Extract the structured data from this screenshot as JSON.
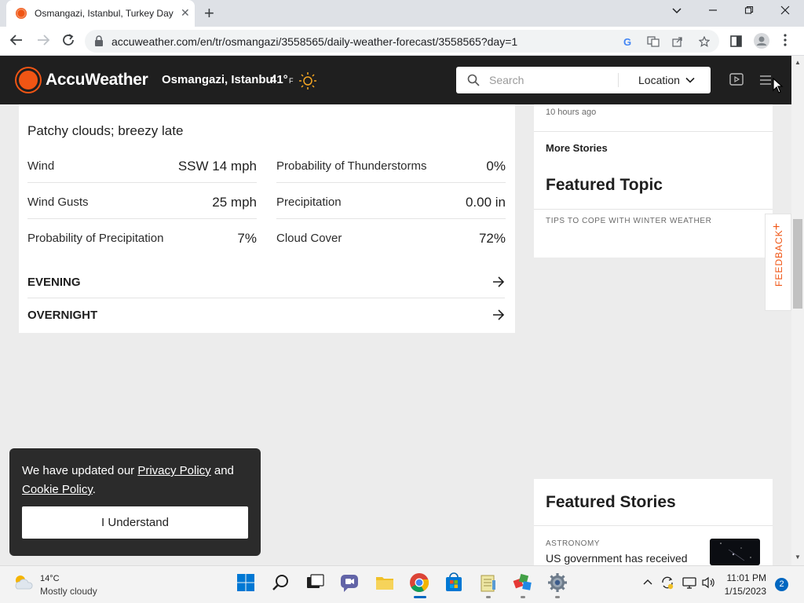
{
  "browser": {
    "tab_title": "Osmangazi, Istanbul, Turkey Day",
    "url": "accuweather.com/en/tr/osmangazi/3558565/daily-weather-forecast/3558565?day=1"
  },
  "header": {
    "brand": "AccuWeather",
    "location": "Osmangazi, Istanbul",
    "temp": "41°",
    "unit": "F",
    "search_placeholder": "Search",
    "location_button": "Location"
  },
  "forecast": {
    "phrase": "Patchy clouds; breezy late",
    "details_left": [
      {
        "label": "Wind",
        "value": "SSW 14 mph"
      },
      {
        "label": "Wind Gusts",
        "value": "25 mph"
      },
      {
        "label": "Probability of Precipitation",
        "value": "7%"
      }
    ],
    "details_right": [
      {
        "label": "Probability of Thunderstorms",
        "value": "0%"
      },
      {
        "label": "Precipitation",
        "value": "0.00 in"
      },
      {
        "label": "Cloud Cover",
        "value": "72%"
      }
    ],
    "periods": [
      "EVENING",
      "OVERNIGHT"
    ]
  },
  "sidebar": {
    "time_ago": "10 hours ago",
    "more_stories": "More Stories",
    "featured_topic": "Featured Topic",
    "topic_link": "TIPS TO COPE WITH WINTER WEATHER",
    "feedback": "FEEDBACK"
  },
  "featured_stories": {
    "heading": "Featured Stories",
    "category": "ASTRONOMY",
    "headline": "US government has received"
  },
  "cookie_banner": {
    "text_before": "We have updated our ",
    "privacy_link": "Privacy Policy",
    "text_middle": " and ",
    "cookie_link": "Cookie Policy",
    "text_after": ".",
    "button": "I Understand"
  },
  "taskbar": {
    "weather_temp": "14°C",
    "weather_condition": "Mostly cloudy",
    "time": "11:01 PM",
    "date": "1/15/2023",
    "notification_count": "2"
  },
  "colors": {
    "brand_orange": "#f05514",
    "header_bg": "#1f1f1f"
  }
}
